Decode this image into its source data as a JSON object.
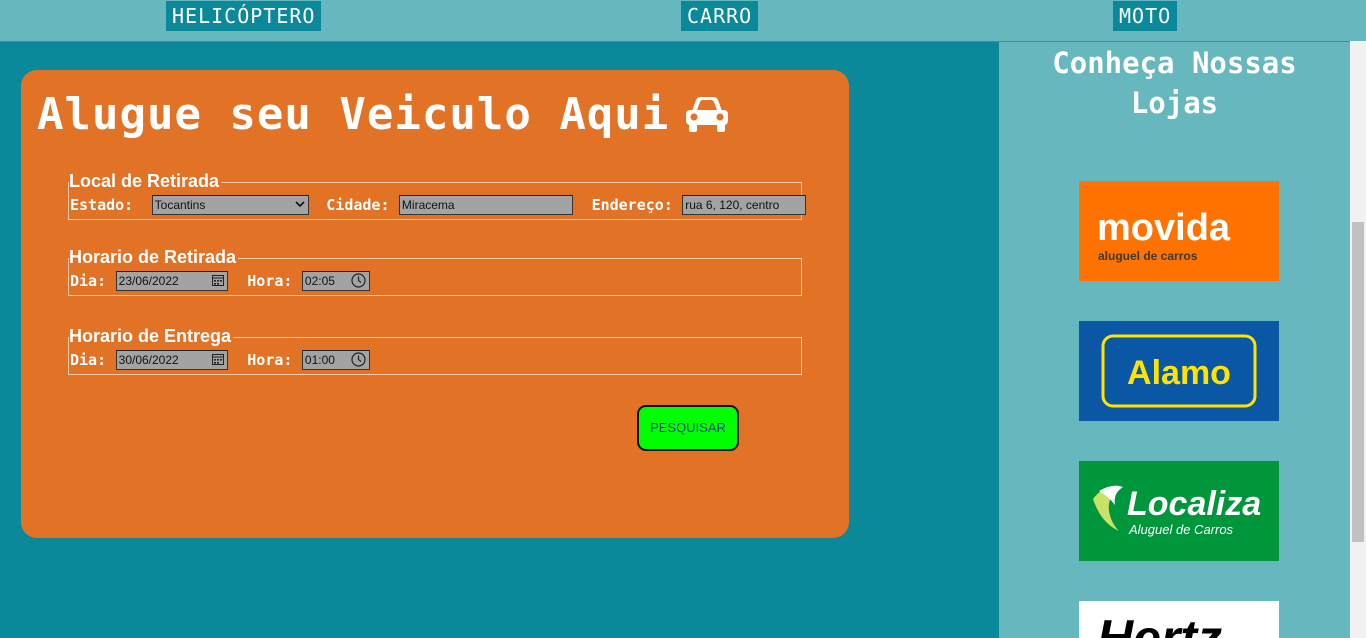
{
  "nav": {
    "helicoptero": "HELICÓPTERO",
    "carro": "CARRO",
    "moto": "MOTO"
  },
  "card": {
    "title": "Alugue seu Veiculo Aqui"
  },
  "retirada_local": {
    "legend": "Local de Retirada",
    "estado_label": "Estado:",
    "estado_value": "Tocantins",
    "cidade_label": "Cidade:",
    "cidade_value": "Miracema",
    "endereco_label": "Endereço:",
    "endereco_value": "rua 6, 120, centro"
  },
  "retirada_horario": {
    "legend": "Horario de Retirada",
    "dia_label": "Dia:",
    "dia_value": "23/06/2022",
    "hora_label": "Hora:",
    "hora_value": "02:05"
  },
  "entrega_horario": {
    "legend": "Horario de Entrega",
    "dia_label": "Dia:",
    "dia_value": "30/06/2022",
    "hora_label": "Hora:",
    "hora_value": "01:00"
  },
  "search_button": "PESQUISAR",
  "sidebar": {
    "title": "Conheça Nossas\nLojas",
    "logos": {
      "movida_main": "movida",
      "movida_sub": "aluguel de carros",
      "alamo": "Alamo",
      "localiza_main": "Localiza",
      "localiza_sub": "Aluguel de Carros",
      "hertz": "Hertz"
    }
  },
  "colors": {
    "background": "#0b899b",
    "nav_bg": "#66b8be",
    "card": "#e27225",
    "button": "#00ff00"
  }
}
